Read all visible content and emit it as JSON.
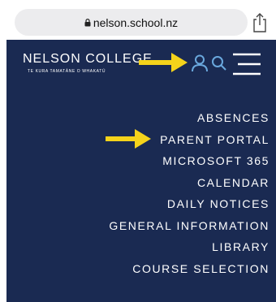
{
  "browser": {
    "url": "nelson.school.nz"
  },
  "header": {
    "title": "NELSON COLLEGE",
    "subtitle": "TE KURA TAMATĀNE O WHAKATŪ"
  },
  "icons": {
    "user": "user-icon",
    "search": "search-icon",
    "menu": "hamburger-menu-icon",
    "share": "share-icon",
    "lock": "lock-icon"
  },
  "menu": {
    "items": [
      {
        "label": "ABSENCES"
      },
      {
        "label": "PARENT PORTAL"
      },
      {
        "label": "MICROSOFT 365"
      },
      {
        "label": "CALENDAR"
      },
      {
        "label": "DAILY NOTICES"
      },
      {
        "label": "GENERAL INFORMATION"
      },
      {
        "label": "LIBRARY"
      },
      {
        "label": "COURSE SELECTION"
      }
    ]
  },
  "colors": {
    "panel": "#1a2a52",
    "accent_arrow": "#f5d31b",
    "icon_blue": "#6aa8dd"
  }
}
